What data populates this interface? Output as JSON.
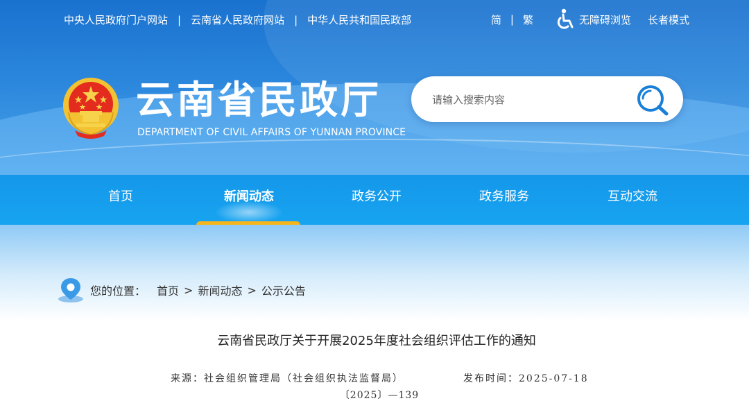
{
  "top_links": [
    "中央人民政府门户网站",
    "云南省人民政府网站",
    "中华人民共和国民政部"
  ],
  "toolbar": {
    "simplified": "简",
    "traditional": "繁",
    "accessible": "无障碍浏览",
    "elder": "长者模式"
  },
  "site": {
    "title": "云南省民政厅",
    "subtitle": "DEPARTMENT OF CIVIL AFFAIRS OF YUNNAN PROVINCE"
  },
  "search": {
    "placeholder": "请输入搜索内容",
    "value": ""
  },
  "nav": [
    "首页",
    "新闻动态",
    "政务公开",
    "政务服务",
    "互动交流"
  ],
  "nav_active": "新闻动态",
  "breadcrumb": {
    "label": "您的位置：",
    "items": [
      "首页",
      "新闻动态",
      "公示公告"
    ],
    "separator": ">"
  },
  "article": {
    "title": "云南省民政厅关于开展2025年度社会组织评估工作的通知",
    "source": "来源：社会组织管理局（社会组织执法监督局）",
    "date": "发布时间：2025-07-18",
    "doc_number": "〔2025〕—139"
  },
  "colors": {
    "header_blue": "#1a72cf",
    "nav_blue": "#16a4f0",
    "active_underline": "#f6b51a"
  },
  "icons": [
    "accessibility-icon",
    "national-emblem",
    "search-icon",
    "location-pin-icon"
  ]
}
